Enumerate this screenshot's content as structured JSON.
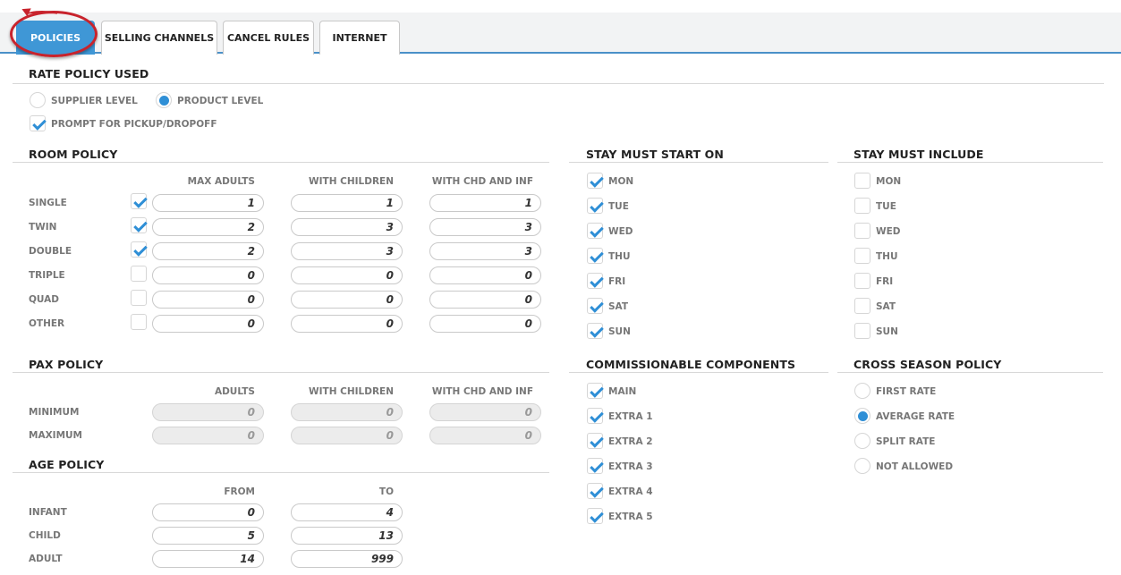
{
  "tabs": [
    {
      "label": "POLICIES"
    },
    {
      "label": "SELLING CHANNELS"
    },
    {
      "label": "CANCEL RULES"
    },
    {
      "label": "INTERNET"
    }
  ],
  "rate_policy": {
    "title": "RATE POLICY USED",
    "supplier_level": "SUPPLIER LEVEL",
    "product_level": "PRODUCT LEVEL",
    "selected": "PRODUCT LEVEL",
    "prompt_pickup": "PROMPT FOR PICKUP/DROPOFF",
    "prompt_pickup_checked": true
  },
  "room_policy": {
    "title": "ROOM POLICY",
    "headers": [
      "MAX ADULTS",
      "WITH CHILDREN",
      "WITH CHD AND INF"
    ],
    "rows": [
      {
        "label": "SINGLE",
        "checked": true,
        "values": [
          "1",
          "1",
          "1"
        ]
      },
      {
        "label": "TWIN",
        "checked": true,
        "values": [
          "2",
          "3",
          "3"
        ]
      },
      {
        "label": "DOUBLE",
        "checked": true,
        "values": [
          "2",
          "3",
          "3"
        ]
      },
      {
        "label": "TRIPLE",
        "checked": false,
        "values": [
          "0",
          "0",
          "0"
        ]
      },
      {
        "label": "QUAD",
        "checked": false,
        "values": [
          "0",
          "0",
          "0"
        ]
      },
      {
        "label": "OTHER",
        "checked": false,
        "values": [
          "0",
          "0",
          "0"
        ]
      }
    ]
  },
  "pax_policy": {
    "title": "PAX POLICY",
    "headers": [
      "ADULTS",
      "WITH CHILDREN",
      "WITH CHD AND INF"
    ],
    "rows": [
      {
        "label": "MINIMUM",
        "values": [
          "0",
          "0",
          "0"
        ]
      },
      {
        "label": "MAXIMUM",
        "values": [
          "0",
          "0",
          "0"
        ]
      }
    ]
  },
  "age_policy": {
    "title": "AGE POLICY",
    "headers": [
      "FROM",
      "TO"
    ],
    "rows": [
      {
        "label": "INFANT",
        "values": [
          "0",
          "4"
        ]
      },
      {
        "label": "CHILD",
        "values": [
          "5",
          "13"
        ]
      },
      {
        "label": "ADULT",
        "values": [
          "14",
          "999"
        ]
      }
    ]
  },
  "stay_start": {
    "title": "STAY MUST START ON",
    "days": [
      {
        "label": "MON",
        "checked": true
      },
      {
        "label": "TUE",
        "checked": true
      },
      {
        "label": "WED",
        "checked": true
      },
      {
        "label": "THU",
        "checked": true
      },
      {
        "label": "FRI",
        "checked": true
      },
      {
        "label": "SAT",
        "checked": true
      },
      {
        "label": "SUN",
        "checked": true
      }
    ]
  },
  "stay_include": {
    "title": "STAY MUST INCLUDE",
    "days": [
      {
        "label": "MON",
        "checked": false
      },
      {
        "label": "TUE",
        "checked": false
      },
      {
        "label": "WED",
        "checked": false
      },
      {
        "label": "THU",
        "checked": false
      },
      {
        "label": "FRI",
        "checked": false
      },
      {
        "label": "SAT",
        "checked": false
      },
      {
        "label": "SUN",
        "checked": false
      }
    ]
  },
  "commissionable": {
    "title": "COMMISSIONABLE COMPONENTS",
    "items": [
      {
        "label": "MAIN",
        "checked": true
      },
      {
        "label": "EXTRA 1",
        "checked": true
      },
      {
        "label": "EXTRA 2",
        "checked": true
      },
      {
        "label": "EXTRA 3",
        "checked": true
      },
      {
        "label": "EXTRA 4",
        "checked": true
      },
      {
        "label": "EXTRA 5",
        "checked": true
      }
    ]
  },
  "cross_season": {
    "title": "CROSS SEASON POLICY",
    "options": [
      {
        "label": "FIRST RATE"
      },
      {
        "label": "AVERAGE RATE"
      },
      {
        "label": "SPLIT RATE"
      },
      {
        "label": "NOT ALLOWED"
      }
    ],
    "selected": "AVERAGE RATE"
  },
  "colors": {
    "accent": "#3f97d6",
    "check": "#2f8fd6",
    "annotation": "#c8232c"
  }
}
